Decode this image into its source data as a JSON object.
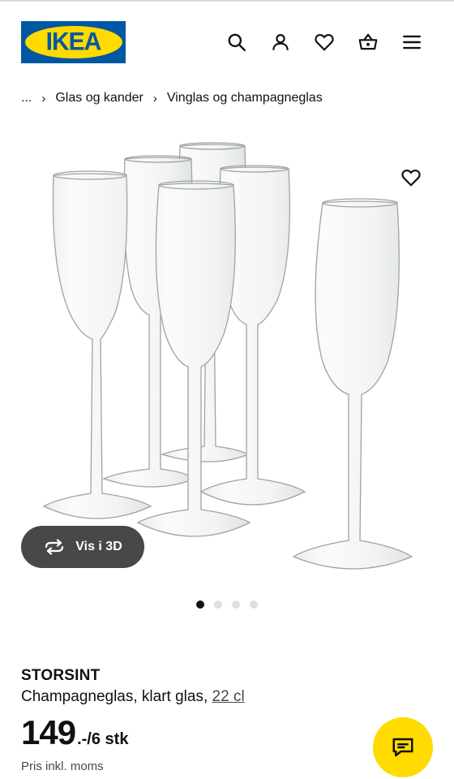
{
  "header": {
    "logo_text": "IKEA",
    "icons": [
      "search-icon",
      "account-icon",
      "heart-icon",
      "basket-icon",
      "menu-icon"
    ]
  },
  "breadcrumb": {
    "ellipsis": "...",
    "items": [
      "Glas og kander",
      "Vinglas og champagneglas"
    ]
  },
  "gallery": {
    "view3d_label": "Vis i 3D",
    "dot_count": 4,
    "active_dot": 1
  },
  "product": {
    "name": "STORSINT",
    "description": "Champagneglas, klart glas,",
    "size": "22 cl",
    "price_integer": "149",
    "price_suffix": ".-/6 stk",
    "price_note": "Pris inkl. moms"
  },
  "colors": {
    "brand_blue": "#0058a3",
    "brand_yellow": "#ffdb00",
    "button_dark": "#484848"
  }
}
